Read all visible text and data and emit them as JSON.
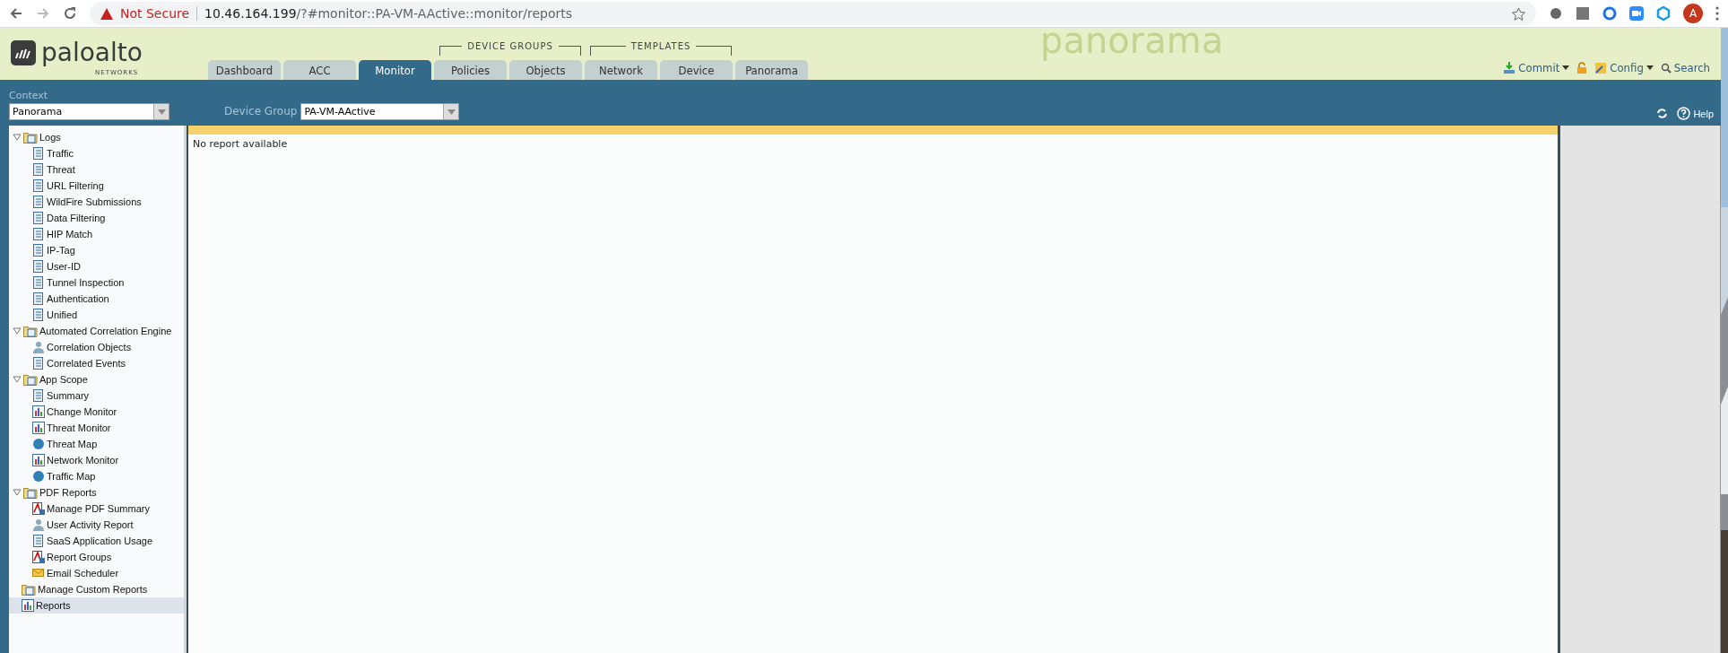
{
  "browser": {
    "security": "Not Secure",
    "url_host": "10.46.164.199",
    "url_path": "/?#monitor::PA-VM-AActive::monitor/reports",
    "avatar": "A"
  },
  "header": {
    "logo_text": "paloalto",
    "logo_sub": "NETWORKS",
    "backdrop_word": "panorama",
    "tab_groups": [
      {
        "label": "DEVICE GROUPS"
      },
      {
        "label": "TEMPLATES"
      }
    ],
    "tabs": [
      {
        "label": "Dashboard",
        "selected": false
      },
      {
        "label": "ACC",
        "selected": false
      },
      {
        "label": "Monitor",
        "selected": true
      },
      {
        "label": "Policies",
        "selected": false
      },
      {
        "label": "Objects",
        "selected": false
      },
      {
        "label": "Network",
        "selected": false
      },
      {
        "label": "Device",
        "selected": false
      },
      {
        "label": "Panorama",
        "selected": false
      }
    ],
    "actions": [
      "Commit",
      "Config",
      "Search"
    ]
  },
  "context_bar": {
    "context_label": "Context",
    "context_value": "Panorama",
    "device_group_label": "Device Group",
    "device_group_value": "PA-VM-AActive",
    "help": "Help"
  },
  "tree": [
    {
      "label": "Logs",
      "expanded": true,
      "selected": false,
      "children": [
        {
          "label": "Traffic",
          "selected": false
        },
        {
          "label": "Threat",
          "selected": false
        },
        {
          "label": "URL Filtering",
          "selected": false
        },
        {
          "label": "WildFire Submissions",
          "selected": false
        },
        {
          "label": "Data Filtering",
          "selected": false
        },
        {
          "label": "HIP Match",
          "selected": false
        },
        {
          "label": "IP-Tag",
          "selected": false
        },
        {
          "label": "User-ID",
          "selected": false
        },
        {
          "label": "Tunnel Inspection",
          "selected": false
        },
        {
          "label": "Authentication",
          "selected": false
        },
        {
          "label": "Unified",
          "selected": false
        }
      ]
    },
    {
      "label": "Automated Correlation Engine",
      "expanded": true,
      "selected": false,
      "children": [
        {
          "label": "Correlation Objects",
          "selected": false
        },
        {
          "label": "Correlated Events",
          "selected": false
        }
      ]
    },
    {
      "label": "App Scope",
      "expanded": true,
      "selected": false,
      "children": [
        {
          "label": "Summary",
          "selected": false
        },
        {
          "label": "Change Monitor",
          "selected": false
        },
        {
          "label": "Threat Monitor",
          "selected": false
        },
        {
          "label": "Threat Map",
          "selected": false
        },
        {
          "label": "Network Monitor",
          "selected": false
        },
        {
          "label": "Traffic Map",
          "selected": false
        }
      ]
    },
    {
      "label": "PDF Reports",
      "expanded": true,
      "selected": false,
      "children": [
        {
          "label": "Manage PDF Summary",
          "selected": false
        },
        {
          "label": "User Activity Report",
          "selected": false
        },
        {
          "label": "SaaS Application Usage",
          "selected": false
        },
        {
          "label": "Report Groups",
          "selected": false
        },
        {
          "label": "Email Scheduler",
          "selected": false
        }
      ]
    },
    {
      "label": "Manage Custom Reports",
      "selected": false
    },
    {
      "label": "Reports",
      "selected": true
    }
  ],
  "main": {
    "message": "No report available"
  }
}
